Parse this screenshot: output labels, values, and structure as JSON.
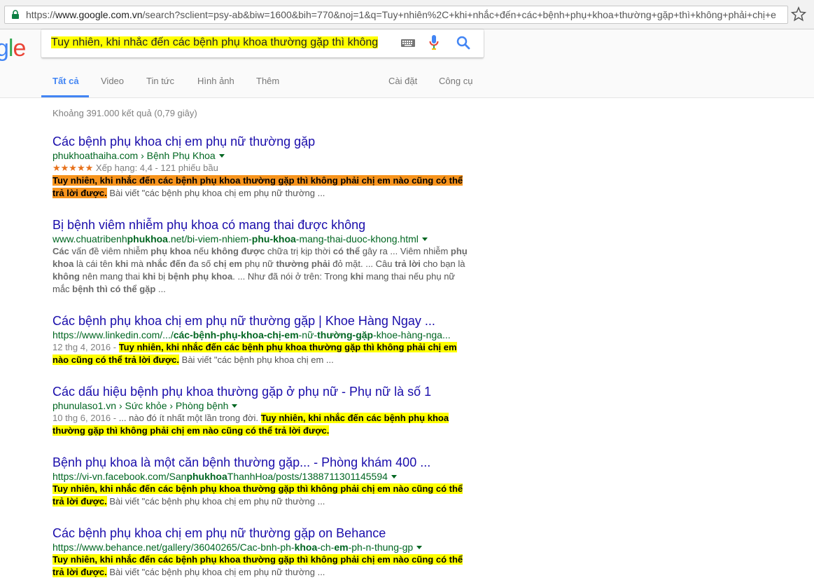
{
  "browser": {
    "url_prefix": "https://",
    "url_host": "www.google.com.vn",
    "url_rest": "/search?sclient=psy-ab&biw=1600&bih=770&noj=1&q=Tuy+nhiên%2C+khi+nhắc+đến+các+bệnh+phụ+khoa+thường+gặp+thì+không+phải+chị+e"
  },
  "search": {
    "logo": "gle",
    "query": "Tuy nhiên, khi nhắc đến các bệnh phụ khoa thường gặp thì không"
  },
  "tabs": {
    "all": "Tất cả",
    "video": "Video",
    "news": "Tin tức",
    "images": "Hình ảnh",
    "more": "Thêm",
    "settings": "Cài đặt",
    "tools": "Công cụ"
  },
  "stats": "Khoảng 391.000 kết quả (0,79 giây)",
  "results": [
    {
      "title": "Các bệnh phụ khoa chị em phụ nữ thường gặp",
      "url": "phukhoathaiha.com › Bệnh Phụ Khoa",
      "rating_stars": "★★★★★",
      "rating_text": "Xếp hạng: 4,4 - 121 phiếu bầu",
      "rating_value": 4.4,
      "hl_1": "Tuy nhiên, khi nhắc đến các bệnh phụ khoa thường gặp thì không phải chị em nào cũng có thể",
      "hl_2": "trả lời được.",
      "rest": " Bài viết \"các bệnh phụ khoa chị em phụ nữ thường ..."
    },
    {
      "title": "Bị bệnh viêm nhiễm phụ khoa có mang thai được không",
      "url_a": "www.chuatribenh",
      "url_b": "phukhoa",
      "url_c": ".net/bi-viem-nhiem-",
      "url_d": "phu-khoa",
      "url_e": "-mang-thai-duoc-khong.html",
      "snippet_lines": [
        [
          "",
          "Các",
          " vấn đề viêm nhiễm ",
          "phụ khoa",
          " nếu ",
          "không được",
          " chữa trị kịp thời ",
          "có thể",
          " gây ra ... Viêm nhiễm ",
          "phụ"
        ],
        [
          "",
          "khoa",
          " là cái tên ",
          "khi",
          " mà ",
          "nhắc đến",
          " đa số ",
          "chị em",
          " phụ nữ ",
          "thường phải",
          " đỏ mặt. ... Câu ",
          "trả lời",
          " cho bạn là"
        ],
        [
          "",
          "không",
          " nên mang thai ",
          "khi",
          " bị ",
          "bệnh phụ khoa",
          ". ... Như đã nói ở trên: Trong ",
          "khi",
          " mang thai nếu phụ nữ"
        ],
        [
          "mắc ",
          "bệnh thì có thể gặp",
          " ..."
        ]
      ]
    },
    {
      "title": "Các bệnh phụ khoa chị em phụ nữ thường gặp | Khoe Hàng Ngay ...",
      "url_a": "https://www.linkedin.com/.../",
      "url_b": "các-bệnh-phụ-khoa-chị-em",
      "url_c": "-nữ-",
      "url_d": "thường-gặp",
      "url_e": "-khoe-hàng-nga...",
      "date": "12 thg 4, 2016 - ",
      "hl_1": "Tuy nhiên, khi nhắc đến các bệnh phụ khoa thường gặp thì không phải chị em",
      "hl_2": "nào cũng có thể trả lời được.",
      "rest": " Bài viết \"các bệnh phụ khoa chị em ..."
    },
    {
      "title": "Các dấu hiệu bệnh phụ khoa thường gặp ở phụ nữ - Phụ nữ là số 1",
      "url": "phunulaso1.vn › Sức khỏe › Phòng bệnh",
      "date": "10 thg 6, 2016 - ",
      "pre": "... nào đó ít nhất một lần trong đời. ",
      "hl_1": "Tuy nhiên, khi nhắc đến các bệnh phụ khoa",
      "hl_2": "thường gặp thì không phải chị em nào cũng có thể trả lời được."
    },
    {
      "title": "Bệnh phụ khoa là một căn bệnh thường gặp... - Phòng khám 400 ...",
      "url_a": "https://vi-vn.facebook.com/San",
      "url_b": "phukhoa",
      "url_c": "ThanhHoa/posts/1388711301145594",
      "hl_1": "Tuy nhiên, khi nhắc đến các bệnh phụ khoa thường gặp thì không phải chị em nào cũng có thể",
      "hl_2": "trả lời được.",
      "rest": " Bài viết \"các bệnh phụ khoa chị em phụ nữ thường ..."
    },
    {
      "title": "Các bệnh phụ khoa chị em phụ nữ thường gặp on Behance",
      "url_a": "https://www.behance.net/gallery/36040265/Cac-bnh-ph-",
      "url_b": "khoa",
      "url_c": "-ch-",
      "url_d": "em",
      "url_e": "-ph-n-thung-gp",
      "hl_1": "Tuy nhiên, khi nhắc đến các bệnh phụ khoa thường gặp thì không phải chị em nào cũng có thể",
      "hl_2": "trả lời được.",
      "rest": " Bài viết \"các bệnh phụ khoa chị em phụ nữ thường ..."
    }
  ],
  "icons": {
    "lock": "lock-icon",
    "star": "bookmark-star-icon",
    "keyboard": "keyboard-icon",
    "mic": "microphone-icon",
    "search": "search-icon"
  },
  "colors": {
    "title": "#1a0dab",
    "url": "#006621",
    "highlight": "#ffff00",
    "highlight_first": "#f7941d",
    "tab_active": "#4285f4"
  }
}
